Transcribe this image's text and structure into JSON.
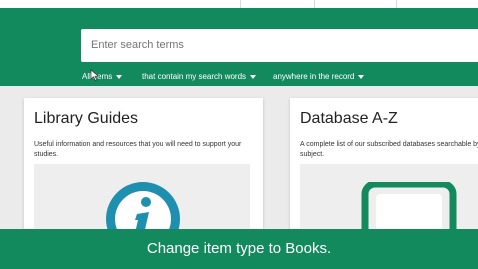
{
  "search": {
    "placeholder": "Enter search terms",
    "filters": [
      {
        "label": "All items"
      },
      {
        "label": "that contain my search words"
      },
      {
        "label": "anywhere in the record"
      }
    ]
  },
  "cards": [
    {
      "title": "Library Guides",
      "description": "Useful information and resources that you will need to support your studies.",
      "icon": "info-icon"
    },
    {
      "title": "Database A-Z",
      "description": "A complete list of our subscribed databases searchable by subject.",
      "icon": "database-icon"
    }
  ],
  "caption": "Change item type to Books.",
  "colors": {
    "brand_green": "#138a5e",
    "icon_teal": "#1f8fb0",
    "background": "#ebebeb"
  }
}
